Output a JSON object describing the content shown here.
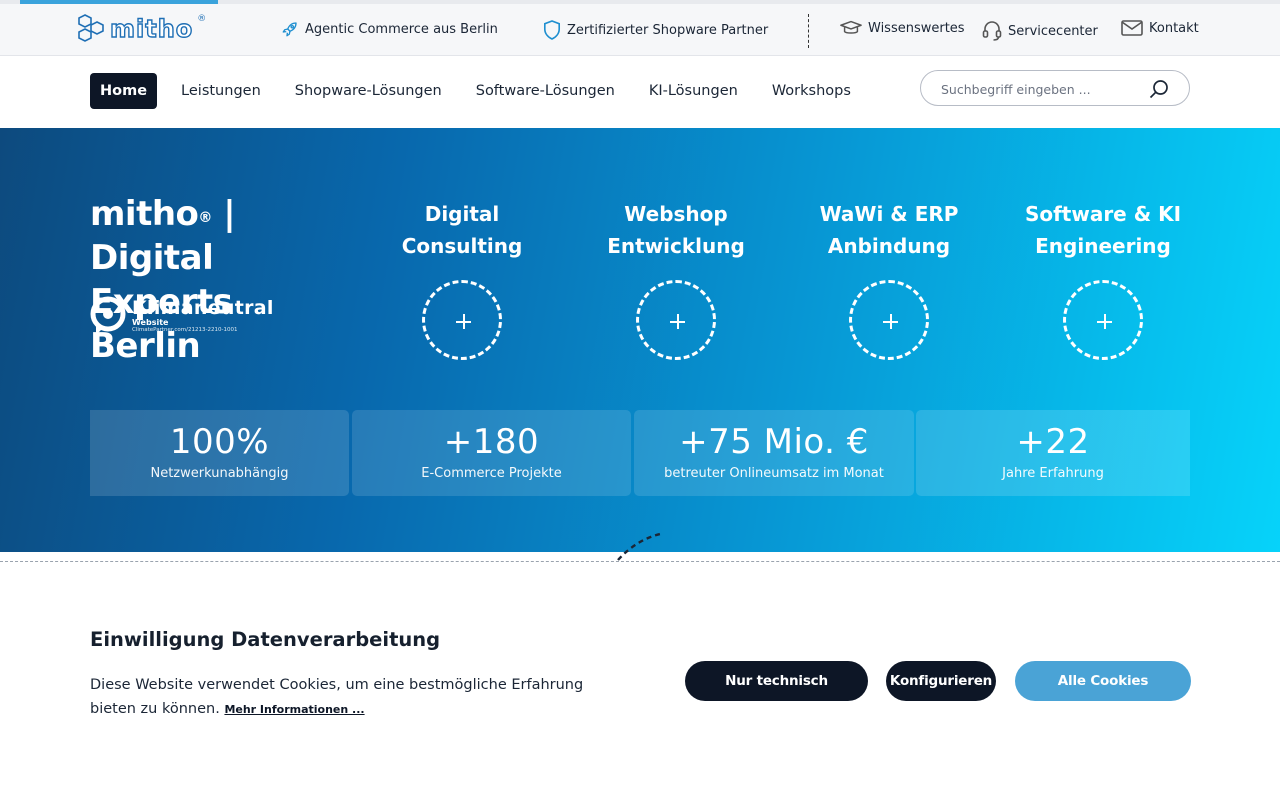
{
  "brand": {
    "logo_text": "mitho",
    "registered": "®"
  },
  "topbar": {
    "usps": [
      {
        "icon": "rocket-icon",
        "label": "Agentic Commerce aus Berlin"
      },
      {
        "icon": "shield-icon",
        "label": "Zertifizierter Shopware Partner"
      }
    ],
    "links": [
      {
        "icon": "graduation-cap-icon",
        "label": "Wissenswertes"
      },
      {
        "icon": "headset-icon",
        "label": "Servicecenter"
      },
      {
        "icon": "envelope-icon",
        "label": "Kontakt"
      }
    ]
  },
  "nav": {
    "items": [
      "Home",
      "Leistungen",
      "Shopware-Lösungen",
      "Software-Lösungen",
      "KI-Lösungen",
      "Workshops"
    ],
    "active": "Home"
  },
  "search": {
    "placeholder": "Suchbegriff eingeben ..."
  },
  "hero": {
    "title_brand": "mitho",
    "title_reg": "®",
    "title_rest": " | Digital Experts Berlin",
    "badge": {
      "main": "Klimaneutral",
      "sub": "Website",
      "id": "ClimatePartner.com/21213-2210-1001"
    },
    "services": [
      {
        "line1": "Digital",
        "line2": "Consulting"
      },
      {
        "line1": "Webshop",
        "line2": "Entwicklung"
      },
      {
        "line1": "WaWi & ERP",
        "line2": "Anbindung"
      },
      {
        "line1": "Software & KI",
        "line2": "Engineering"
      }
    ],
    "stats": [
      {
        "value": "100%",
        "label": "Netzwerkunabhängig"
      },
      {
        "value": "+180",
        "label": "E-Commerce Projekte"
      },
      {
        "value": "+75 Mio. €",
        "label": "betreuter Onlineumsatz im Monat"
      },
      {
        "value": "+22",
        "label": "Jahre Erfahrung"
      }
    ]
  },
  "cookie": {
    "title": "Einwilligung Datenverarbeitung",
    "text": "Diese Website verwendet Cookies, um eine bestmögliche Erfahrung bieten zu können.",
    "link": "Mehr Informationen ...",
    "buttons": {
      "necessary": "Nur technisch notwendige",
      "configure": "Konfigurieren",
      "accept_all": "Alle Cookies akzeptieren"
    }
  },
  "colors": {
    "brand_blue": "#1f6fb5",
    "dark": "#0d1626",
    "accent": "#4aa3d6"
  }
}
